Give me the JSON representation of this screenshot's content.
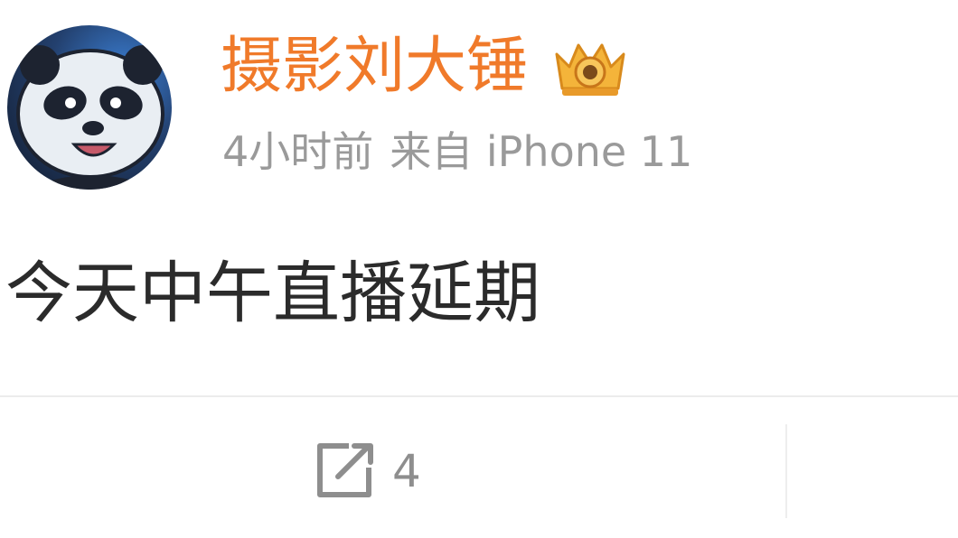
{
  "post": {
    "author": {
      "username": "摄影刘大锤",
      "avatar": "panda-avatar",
      "badge": "crown-badge-icon"
    },
    "meta": {
      "time": "4小时前",
      "source": "来自 iPhone 11"
    },
    "content": "今天中午直播延期",
    "actions": {
      "repost": {
        "icon": "share-icon",
        "count": "4"
      }
    }
  },
  "colors": {
    "username": "#f07a2a",
    "meta": "#9a9a9a",
    "content": "#2b2b2b",
    "action": "#8e8e8e",
    "divider": "#ececec"
  }
}
